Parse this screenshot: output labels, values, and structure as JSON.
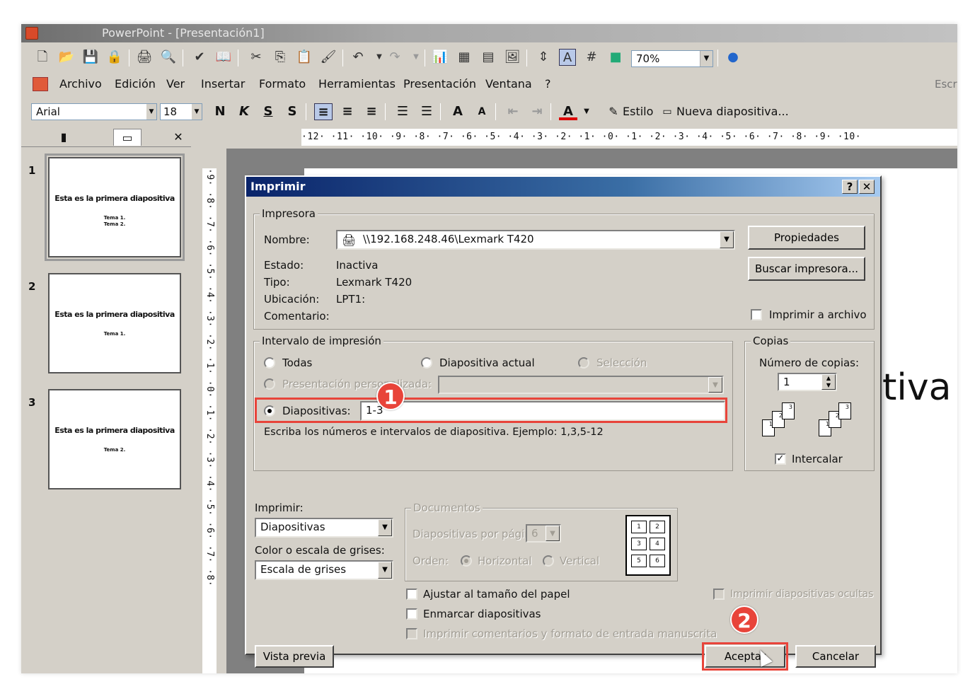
{
  "window": {
    "title": "PowerPoint - [Presentación1]"
  },
  "menubar": {
    "items": [
      "Archivo",
      "Edición",
      "Ver",
      "Insertar",
      "Formato",
      "Herramientas",
      "Presentación",
      "Ventana",
      "?"
    ],
    "search_hint": "Escr"
  },
  "toolbar": {
    "zoom": "70%"
  },
  "format_toolbar": {
    "font": "Arial",
    "size": "18",
    "style_label": "Estilo",
    "new_slide_label": "Nueva diapositiva..."
  },
  "hruler": "·12· ·11· ·10· ·9· ·8· ·7· ·6· ·5· ·4· ·3· ·2· ·1· ·0· ·1· ·2· ·3· ·4· ·5· ·6· ·7· ·8· ·9· ·10·",
  "vruler": "·9· ·8· ·7· ·6· ·5· ·4· ·3· ·2· ·1· ·0· ·1· ·2· ·3· ·4· ·5· ·6· ·7· ·8·",
  "slides": [
    {
      "num": "1",
      "title": "Esta es la primera diapositiva",
      "sub1": "Tema 1.",
      "sub2": "Tema 2."
    },
    {
      "num": "2",
      "title": "Esta es la primera diapositiva",
      "sub1": "Tema 1.",
      "sub2": ""
    },
    {
      "num": "3",
      "title": "Esta es la primera diapositiva",
      "sub1": "Tema 2.",
      "sub2": ""
    }
  ],
  "slide_peek_text": "tiva",
  "dialog": {
    "title": "Imprimir",
    "help_btn": "?",
    "close_btn": "✕",
    "printer": {
      "group_label": "Impresora",
      "name_label": "Nombre:",
      "name_value": "\\\\192.168.248.46\\Lexmark T420",
      "status_label": "Estado:",
      "status_value": "Inactiva",
      "type_label": "Tipo:",
      "type_value": "Lexmark T420",
      "location_label": "Ubicación:",
      "location_value": "LPT1:",
      "comment_label": "Comentario:",
      "properties_btn": "Propiedades",
      "find_printer_btn": "Buscar impresora...",
      "print_to_file_label": "Imprimir a archivo"
    },
    "range": {
      "group_label": "Intervalo de impresión",
      "all_label": "Todas",
      "current_label": "Diapositiva actual",
      "selection_label": "Selección",
      "custom_label": "Presentación personalizada:",
      "slides_label": "Diapositivas:",
      "slides_value": "1-3",
      "hint": "Escriba los números e intervalos de diapositiva. Ejemplo: 1,3,5-12"
    },
    "copies": {
      "group_label": "Copias",
      "count_label": "Número de copias:",
      "count_value": "1",
      "collate_label": "Intercalar"
    },
    "print_what": {
      "label": "Imprimir:",
      "value": "Diapositivas",
      "color_label": "Color o escala de grises:",
      "color_value": "Escala de grises"
    },
    "handouts": {
      "group_label": "Documentos",
      "per_page_label": "Diapositivas por página:",
      "per_page_value": "6",
      "order_label": "Orden:",
      "horizontal_label": "Horizontal",
      "vertical_label": "Vertical"
    },
    "options": {
      "scale_label": "Ajustar al tamaño del papel",
      "frame_label": "Enmarcar diapositivas",
      "comments_label": "Imprimir comentarios y formato de entrada manuscrita",
      "hidden_label": "Imprimir diapositivas ocultas"
    },
    "preview_btn": "Vista previa",
    "ok_btn": "Aceptar",
    "cancel_btn": "Cancelar"
  },
  "annotations": {
    "badge1": "1",
    "badge2": "2",
    "accent": "#e8443a"
  }
}
